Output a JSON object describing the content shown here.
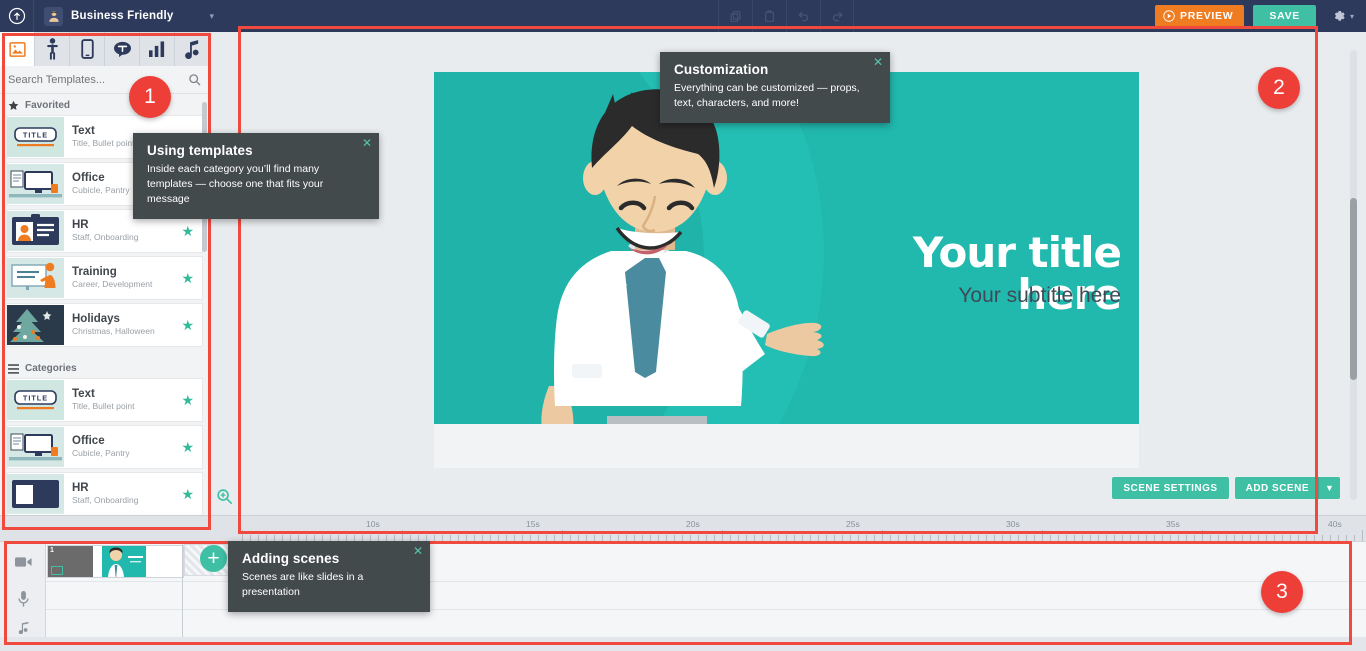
{
  "topbar": {
    "logo_icon": "cloud-upload-icon",
    "project_avatar_icon": "user-avatar-icon",
    "project_title": "Business Friendly",
    "project_caret_icon": "chevron-down-icon",
    "center_tools": [
      {
        "name": "copy-icon",
        "label": "Copy"
      },
      {
        "name": "paste-icon",
        "label": "Paste"
      },
      {
        "name": "undo-icon",
        "label": "Undo"
      },
      {
        "name": "redo-icon",
        "label": "Redo"
      }
    ],
    "preview_label": "PREVIEW",
    "preview_icon": "play-circle-icon",
    "save_label": "SAVE",
    "settings_icon": "gear-icon",
    "settings_caret_icon": "chevron-down-icon",
    "colors": {
      "bar": "#2d3a5c",
      "preview": "#f07c21",
      "save": "#3fc0a5"
    }
  },
  "sidebar": {
    "tabs": [
      {
        "name": "tab-templates",
        "icon": "image-icon",
        "active": true
      },
      {
        "name": "tab-characters",
        "icon": "person-icon",
        "active": false
      },
      {
        "name": "tab-props",
        "icon": "mobile-icon",
        "active": false
      },
      {
        "name": "tab-speech",
        "icon": "speech-bubble-icon",
        "active": false
      },
      {
        "name": "tab-charts",
        "icon": "bar-chart-icon",
        "active": false
      },
      {
        "name": "tab-music",
        "icon": "music-note-icon",
        "active": false
      }
    ],
    "search": {
      "placeholder": "Search Templates...",
      "value": "",
      "icon": "search-icon"
    },
    "sections": [
      {
        "id": "favorited",
        "label": "Favorited",
        "icon": "star-icon",
        "items": [
          {
            "name": "Text",
            "sub": "Title, Bullet point",
            "starred": false,
            "thumb": "title-banner"
          },
          {
            "name": "Office",
            "sub": "Cubicle, Pantry",
            "starred": true,
            "thumb": "desktop-monitor"
          },
          {
            "name": "HR",
            "sub": "Staff, Onboarding",
            "starred": true,
            "thumb": "id-badge"
          },
          {
            "name": "Training",
            "sub": "Career, Development",
            "starred": true,
            "thumb": "whiteboard-presenter"
          },
          {
            "name": "Holidays",
            "sub": "Christmas, Halloween",
            "starred": true,
            "thumb": "christmas-tree"
          }
        ]
      },
      {
        "id": "categories",
        "label": "Categories",
        "icon": "list-icon",
        "items": [
          {
            "name": "Text",
            "sub": "Title, Bullet point",
            "starred": true,
            "thumb": "title-banner"
          },
          {
            "name": "Office",
            "sub": "Cubicle, Pantry",
            "starred": true,
            "thumb": "desktop-monitor"
          },
          {
            "name": "HR",
            "sub": "Staff, Onboarding",
            "starred": true,
            "thumb": "id-badge"
          }
        ]
      }
    ]
  },
  "stage": {
    "canvas": {
      "title": "Your title here",
      "subtitle": "Your subtitle here",
      "background_color": "#21b8ae",
      "character": "business-man-presenting"
    },
    "zoom_icon": "zoom-in-icon",
    "scene_settings_label": "SCENE SETTINGS",
    "add_scene_label": "ADD SCENE",
    "add_scene_caret_icon": "chevron-down-icon",
    "scrollbar": "vertical-scrollbar"
  },
  "ruler": {
    "labels": [
      "10s",
      "15s",
      "20s",
      "25s",
      "30s",
      "35s",
      "40s"
    ],
    "positions": [
      369,
      530,
      690,
      850,
      1010,
      1170,
      1332
    ]
  },
  "timeline": {
    "tracks": [
      {
        "name": "video-track",
        "icon": "video-camera-icon"
      },
      {
        "name": "voice-track",
        "icon": "microphone-icon"
      },
      {
        "name": "music-track",
        "icon": "music-note-icon"
      }
    ],
    "scene_number": "1",
    "add_scene_icon": "plus-icon"
  },
  "tooltips": [
    {
      "id": "templates",
      "title": "Using templates",
      "body": "Inside each category you’ll find many templates — choose one that fits your message",
      "close_icon": "close-icon"
    },
    {
      "id": "customization",
      "title": "Customization",
      "body": "Everything can be customized — props, text, characters, and more!",
      "close_icon": "close-icon"
    },
    {
      "id": "scenes",
      "title": "Adding scenes",
      "body": "Scenes are like slides in a presentation",
      "close_icon": "close-icon"
    }
  ],
  "annotations": {
    "color": "#f04a3f",
    "badges": [
      "1",
      "2",
      "3"
    ]
  }
}
